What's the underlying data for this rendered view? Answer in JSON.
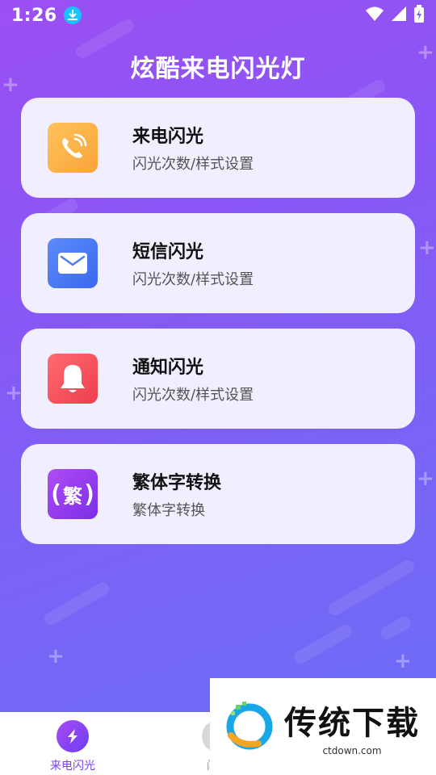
{
  "status_bar": {
    "time": "1:26"
  },
  "app": {
    "title": "炫酷来电闪光灯"
  },
  "cards": [
    {
      "title": "来电闪光",
      "subtitle": "闪光次数/样式设置",
      "icon": "phone-icon",
      "color": "#fbb54a"
    },
    {
      "title": "短信闪光",
      "subtitle": "闪光次数/样式设置",
      "icon": "mail-icon",
      "color": "#4d7cf5"
    },
    {
      "title": "通知闪光",
      "subtitle": "闪光次数/样式设置",
      "icon": "bell-icon",
      "color": "#f3535f"
    },
    {
      "title": "繁体字转换",
      "subtitle": "繁体字转换",
      "icon": "traditional-char-icon",
      "icon_char": "繁",
      "color": "#9b3ff0"
    }
  ],
  "bottom_nav": {
    "items": [
      {
        "label": "来电闪光",
        "active": true
      },
      {
        "label": "闪光",
        "active": false
      }
    ],
    "active_color": "#7a3ff0"
  },
  "watermark": {
    "title": "传统下载",
    "url": "ctdown.com"
  }
}
